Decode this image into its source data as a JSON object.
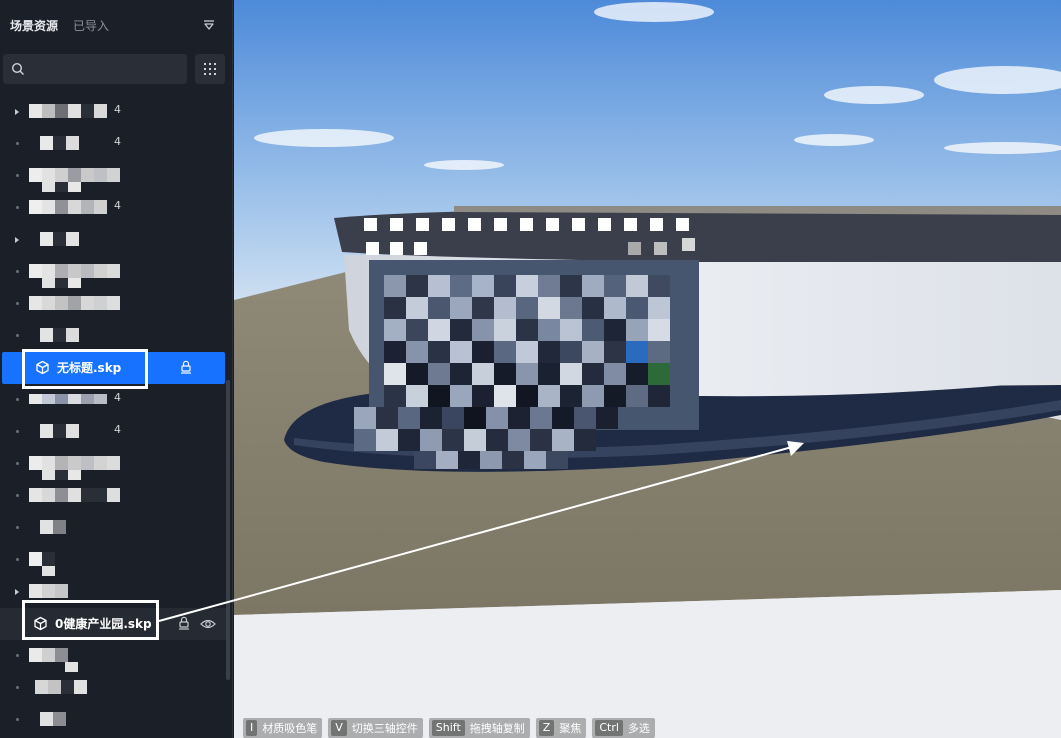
{
  "sidebar": {
    "tabs": [
      {
        "label": "场景资源",
        "active": true
      },
      {
        "label": "已导入",
        "active": false
      }
    ],
    "search": {
      "value": "",
      "placeholder": ""
    },
    "items": [
      {
        "name": "无标题.skp",
        "selected": true,
        "icon": "cube-icon",
        "actions": [
          "lock-icon"
        ]
      },
      {
        "name": "0健康产业园.skp",
        "selected": false,
        "icon": "cube-icon",
        "actions": [
          "lock-icon",
          "eye-icon"
        ]
      }
    ],
    "redacted_suffixes": [
      "4",
      "4",
      "4",
      "4",
      "4"
    ]
  },
  "shortcuts": [
    {
      "key": "I",
      "action": "材质吸色笔"
    },
    {
      "key": "V",
      "action": "切换三轴控件"
    },
    {
      "key": "Shift",
      "action": "拖拽轴复制"
    },
    {
      "key": "Z",
      "action": "聚焦"
    },
    {
      "key": "Ctrl",
      "action": "多选"
    }
  ],
  "colors": {
    "selection": "#1672ff",
    "sidebar_bg": "#1b1f27",
    "annotation": "#ffffff"
  }
}
